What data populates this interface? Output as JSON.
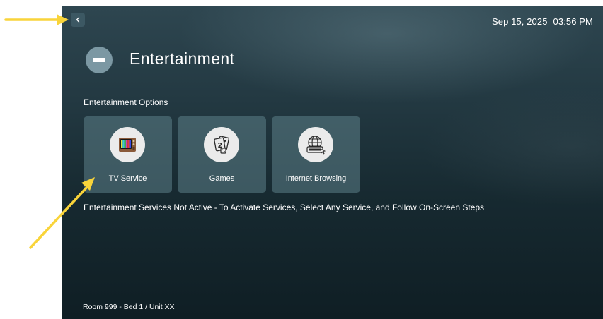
{
  "header": {
    "date": "Sep 15, 2025",
    "time": "03:56 PM",
    "title": "Entertainment",
    "back_icon": "chevron-left-icon"
  },
  "section": {
    "label": "Entertainment Options"
  },
  "tiles": [
    {
      "label": "TV Service",
      "icon": "tv-icon"
    },
    {
      "label": "Games",
      "icon": "game-cards-icon"
    },
    {
      "label": "Internet Browsing",
      "icon": "globe-www-icon"
    }
  ],
  "notice": "Entertainment Services Not Active - To Activate Services, Select Any Service, and Follow On-Screen Steps",
  "footer": {
    "room": "Room 999  -  Bed  1 / Unit XX"
  },
  "colors": {
    "annotation_arrow": "#f9d43a",
    "tile_bg": "#5c8089",
    "header_icon_bg": "#7c98a3"
  }
}
